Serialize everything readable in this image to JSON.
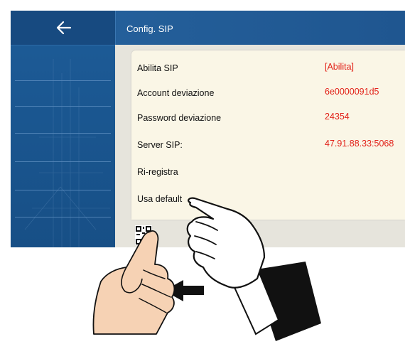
{
  "header": {
    "title": "Config. SIP"
  },
  "sidebar": {
    "back_icon": "arrow-left-icon"
  },
  "settings": [
    {
      "label": "Abilita SIP",
      "value": "[Abilita]"
    },
    {
      "label": "Account deviazione",
      "value": "6e0000091d5"
    },
    {
      "label": "Password deviazione",
      "value": "24354"
    },
    {
      "label": "Server SIP:",
      "value": "47.91.88.33:5068"
    },
    {
      "label": "Ri-registra",
      "value": ""
    },
    {
      "label": "Usa default",
      "value": ""
    }
  ],
  "colors": {
    "accent_blue": "#1f5690",
    "value_red": "#e2231a",
    "panel": "#faf6e6"
  },
  "illustration": {
    "icons": [
      "qr-code-icon",
      "pointing-hand-icon",
      "swipe-left-arrow-icon"
    ]
  }
}
